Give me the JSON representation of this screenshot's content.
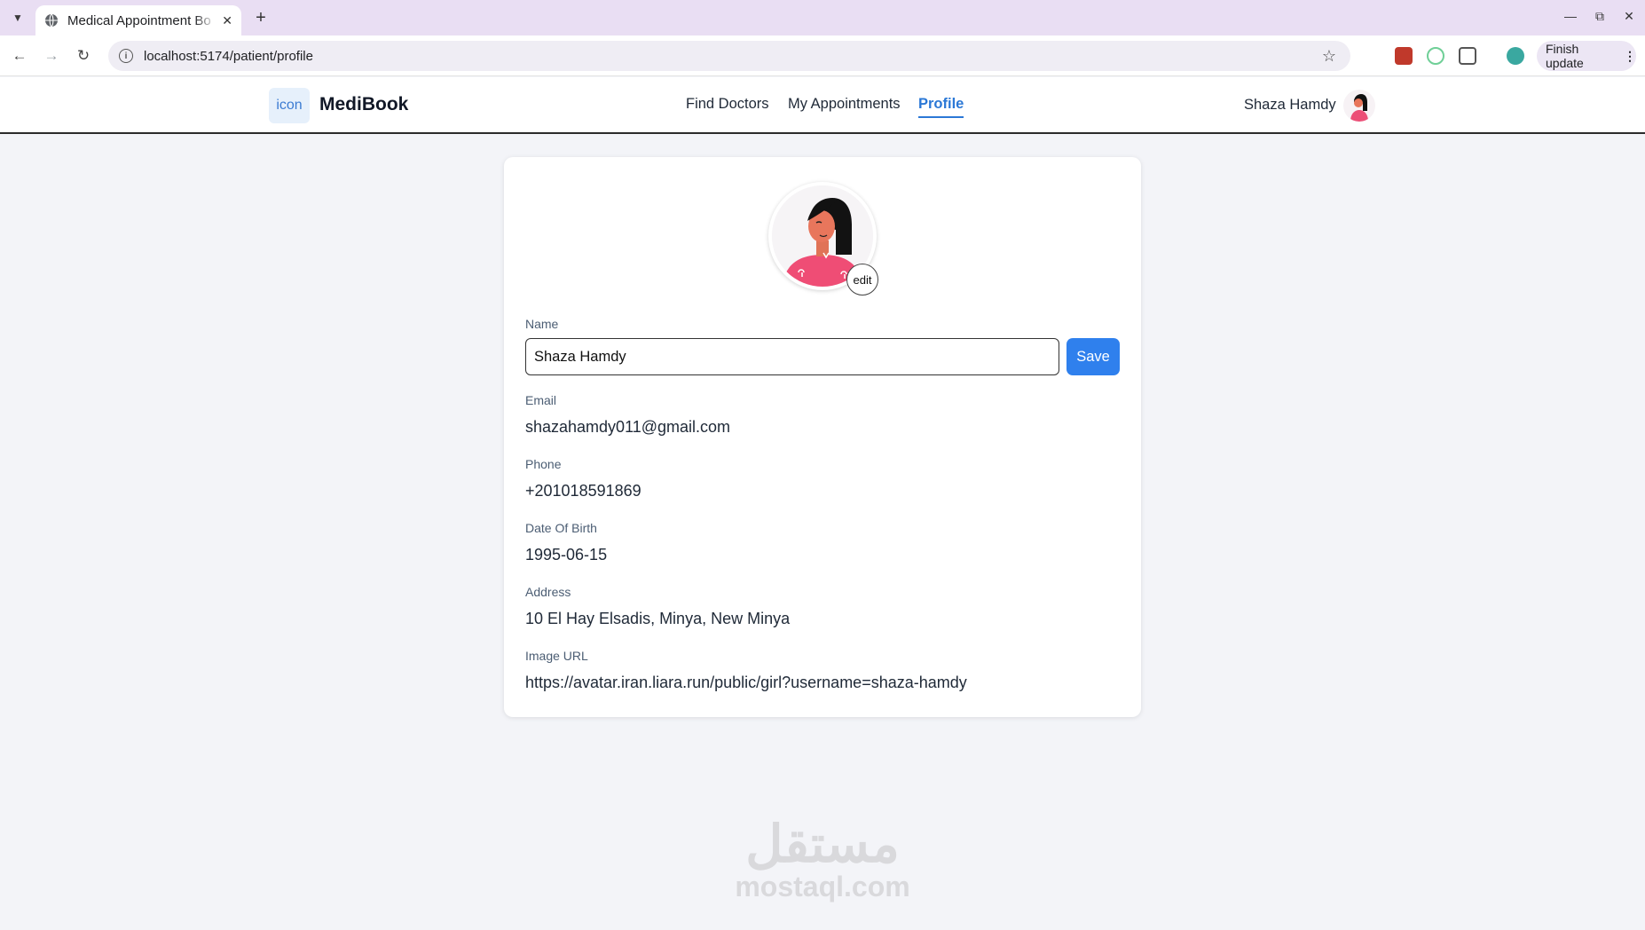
{
  "browser": {
    "tab_title": "Medical Appointment Bo",
    "url": "localhost:5174/patient/profile",
    "finish_update_label": "Finish update",
    "icons": [
      "tab-list-icon",
      "globe-icon",
      "close-icon",
      "plus-icon",
      "minimize-icon",
      "restore-icon",
      "back-icon",
      "forward-icon",
      "reload-icon",
      "info-icon",
      "star-icon",
      "puzzle-icon",
      "more-icon"
    ]
  },
  "header": {
    "logo_text": "icon",
    "brand": "MediBook",
    "nav": [
      {
        "label": "Find Doctors",
        "active": false
      },
      {
        "label": "My Appointments",
        "active": false
      },
      {
        "label": "Profile",
        "active": true
      }
    ],
    "user_name": "Shaza Hamdy",
    "accent_color": "#2b78d6"
  },
  "profile": {
    "edit_label": "edit",
    "name_label": "Name",
    "name_value": "Shaza Hamdy",
    "save_label": "Save",
    "email_label": "Email",
    "email_value": "shazahamdy011@gmail.com",
    "phone_label": "Phone",
    "phone_value": "+201018591869",
    "dob_label": "Date Of Birth",
    "dob_value": "1995-06-15",
    "address_label": "Address",
    "address_value": "10 El Hay Elsadis, Minya, New Minya",
    "image_url_label": "Image URL",
    "image_url_value": "https://avatar.iran.liara.run/public/girl?username=shaza-hamdy"
  },
  "watermark": {
    "arabic": "مستقل",
    "latin": "mostaql.com"
  }
}
